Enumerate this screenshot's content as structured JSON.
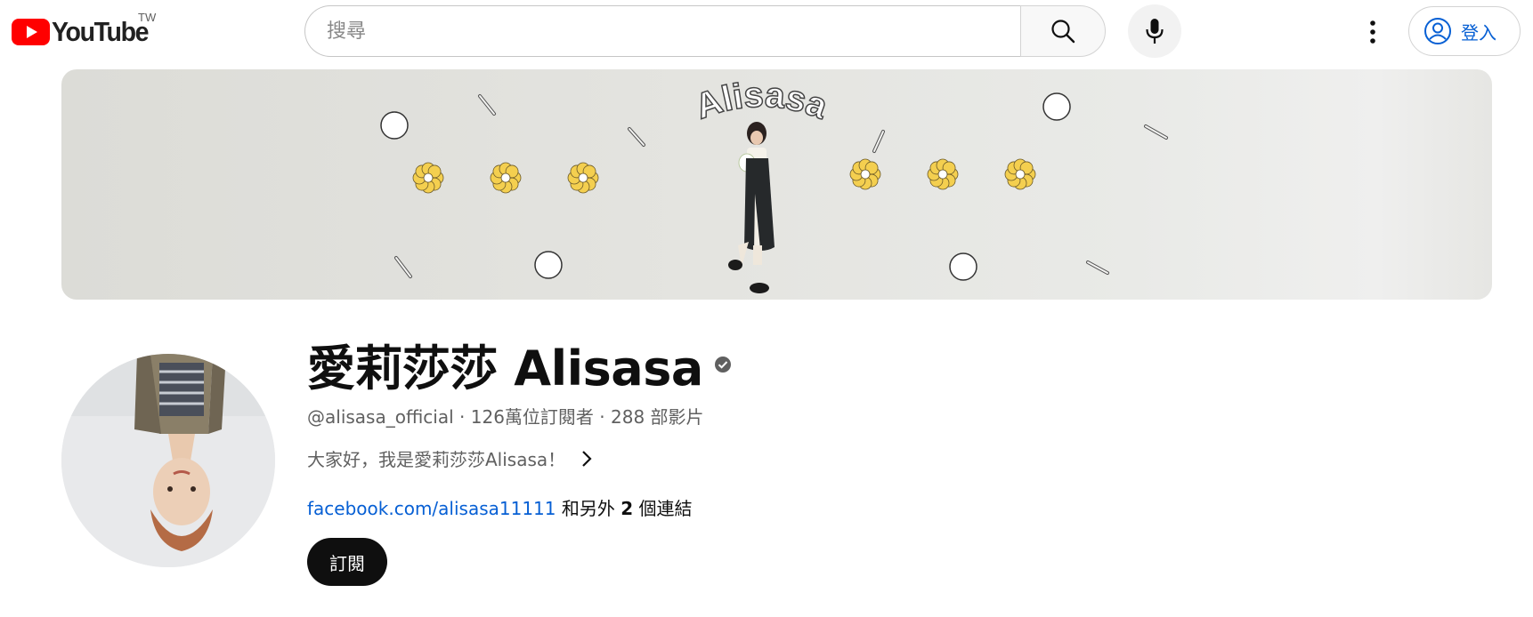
{
  "header": {
    "logo_text": "YouTube",
    "region": "TW",
    "search_placeholder": "搜尋",
    "signin_label": "登入"
  },
  "banner": {
    "title_text": "Alisasa"
  },
  "channel": {
    "name": "愛莉莎莎 Alisasa",
    "handle": "@alisasa_official",
    "subscribers": "126萬位訂閱者",
    "videos": "288 部影片",
    "separator": " · ",
    "description": "大家好，我是愛莉莎莎Alisasa！",
    "link_text": "facebook.com/alisasa11111",
    "more_links_prefix": " 和另外 ",
    "more_links_count": "2",
    "more_links_suffix": " 個連結",
    "subscribe_label": "訂閱"
  },
  "colors": {
    "brand_red": "#ff0000",
    "link_blue": "#065fd4",
    "subscribe_bg": "#0f0f0f"
  },
  "icons": [
    "youtube-logo-icon",
    "search-icon",
    "mic-icon",
    "more-vert-icon",
    "account-icon",
    "verified-icon",
    "chevron-right-icon"
  ]
}
